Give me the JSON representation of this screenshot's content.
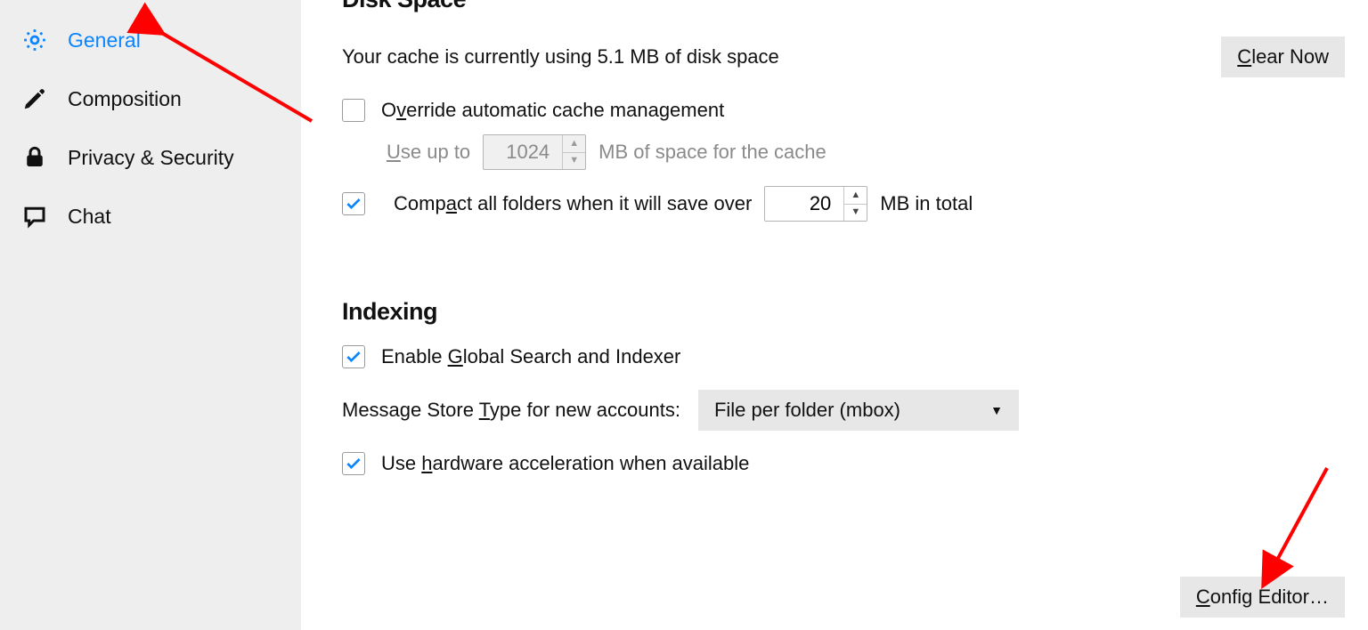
{
  "sidebar": {
    "items": [
      {
        "label": "General",
        "active": true
      },
      {
        "label": "Composition",
        "active": false
      },
      {
        "label": "Privacy & Security",
        "active": false
      },
      {
        "label": "Chat",
        "active": false
      }
    ]
  },
  "disk_space": {
    "title": "Disk Space",
    "cache_text_pre": "Your cache is currently using ",
    "cache_size": "5.1 MB",
    "cache_text_post": " of disk space",
    "clear_now_label": "Clear Now",
    "override_checked": false,
    "override_pre": "O",
    "override_u": "v",
    "override_post": "erride automatic cache management",
    "use_up_to_pre": "U",
    "use_up_to_u": "",
    "use_up_to_post": "se up to",
    "cache_limit_value": "1024",
    "cache_limit_suffix": "MB of space for the cache",
    "compact_checked": true,
    "compact_pre": "Comp",
    "compact_u": "a",
    "compact_post": "ct all folders when it will save over",
    "compact_value": "20",
    "compact_suffix": "MB in total"
  },
  "indexing": {
    "title": "Indexing",
    "global_search_checked": true,
    "global_search_pre": "Enable ",
    "global_search_u": "G",
    "global_search_post": "lobal Search and Indexer",
    "store_type_pre": "Message Store ",
    "store_type_u": "T",
    "store_type_post": "ype for new accounts:",
    "store_type_value": "File per folder (mbox)",
    "hw_accel_checked": true,
    "hw_accel_pre": "Use ",
    "hw_accel_u": "h",
    "hw_accel_post": "ardware acceleration when available"
  },
  "footer": {
    "config_editor_pre": "C",
    "config_editor_u": "",
    "config_editor_post": "onfig Editor…"
  }
}
